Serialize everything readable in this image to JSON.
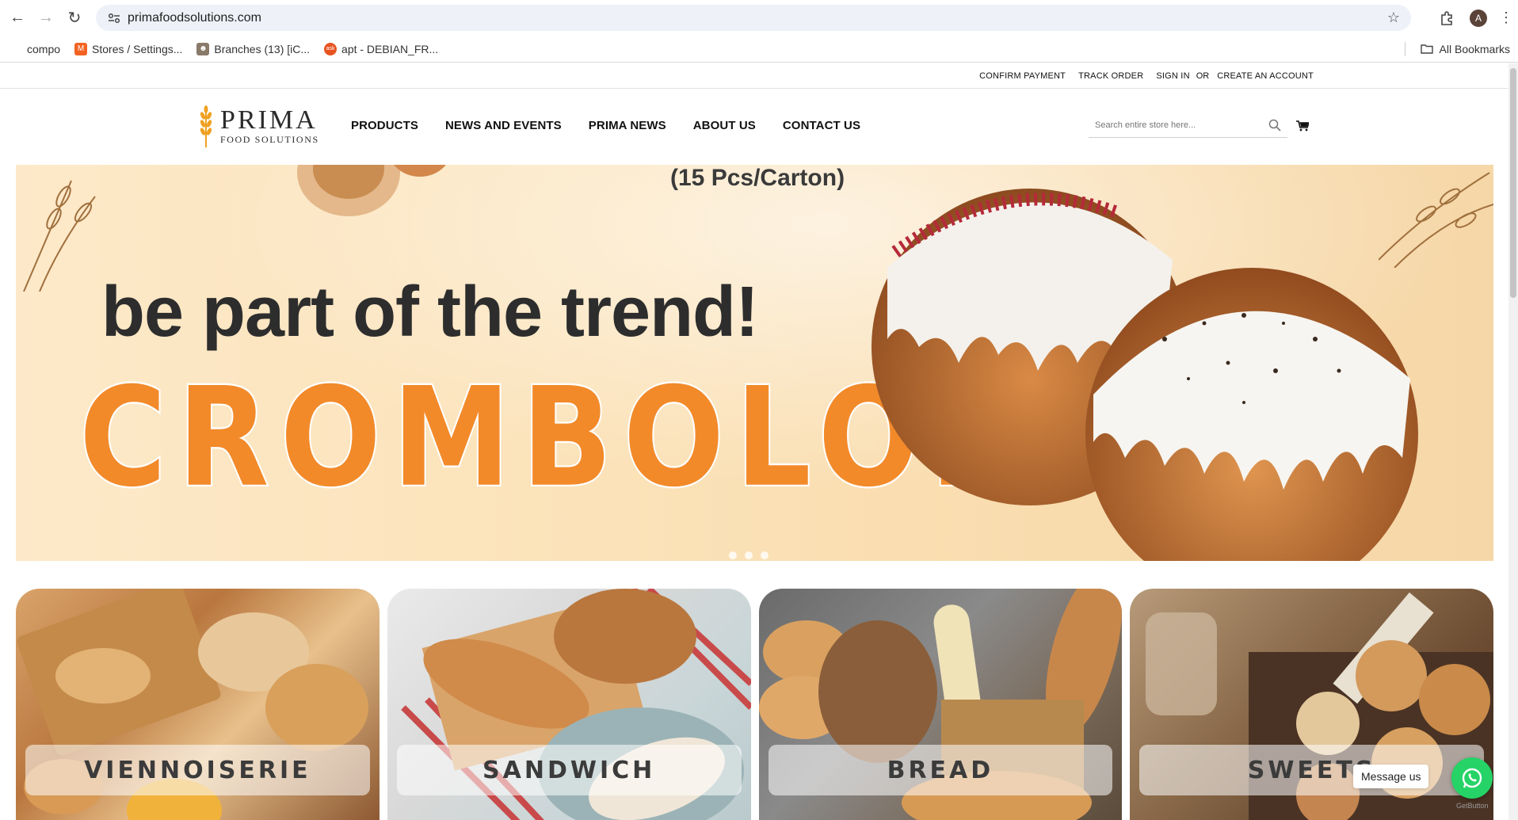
{
  "browser": {
    "url": "primafoodsolutions.com",
    "profile_initial": "A",
    "bookmarks": [
      {
        "label": "compo",
        "icon": "none"
      },
      {
        "label": "Stores / Settings...",
        "icon": "magento-icon"
      },
      {
        "label": "Branches (13) [iC...",
        "icon": "person-icon"
      },
      {
        "label": "apt - DEBIAN_FR...",
        "icon": "ask-icon"
      }
    ],
    "all_bookmarks_label": "All Bookmarks"
  },
  "topbar": {
    "confirm_payment": "CONFIRM PAYMENT",
    "track_order": "TRACK ORDER",
    "sign_in": "SIGN IN",
    "or": "OR",
    "create_account": "CREATE AN ACCOUNT"
  },
  "header": {
    "logo_main": "PRIMA",
    "logo_sub": "FOOD SOLUTIONS",
    "nav": [
      "PRODUCTS",
      "NEWS AND EVENTS",
      "PRIMA NEWS",
      "ABOUT US",
      "CONTACT US"
    ],
    "search_placeholder": "Search entire store here..."
  },
  "hero": {
    "pcs": "(15 Pcs/Carton)",
    "tagline": "be part of the trend!",
    "product": "CROMBOLONI"
  },
  "categories": [
    {
      "label": "VIENNOISERIE"
    },
    {
      "label": "SANDWICH"
    },
    {
      "label": "BREAD"
    },
    {
      "label": "SWEETS"
    }
  ],
  "whatsapp": {
    "message": "Message us",
    "powered": "GetButton"
  },
  "colors": {
    "accent_orange": "#f28a2a",
    "whatsapp_green": "#25d366"
  }
}
